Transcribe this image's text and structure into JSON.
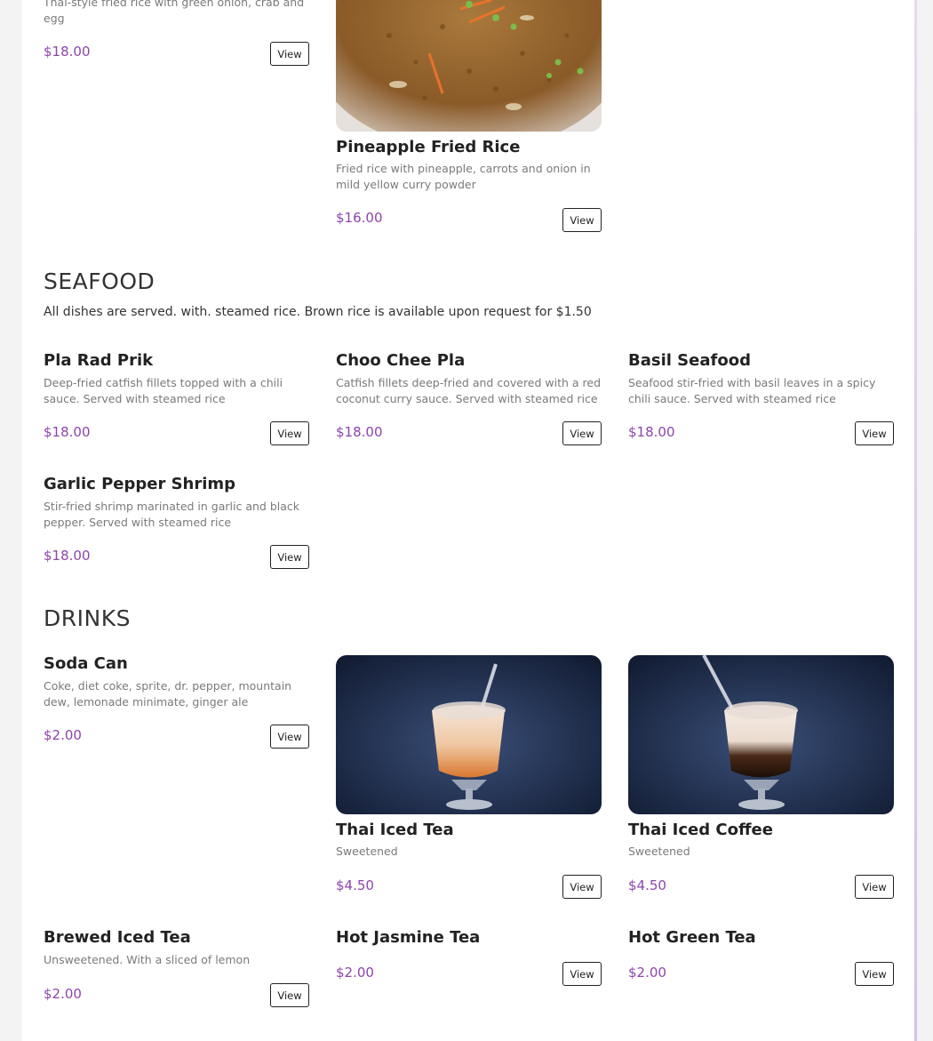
{
  "colors": {
    "price": "#8e44ad",
    "background": "#ffffff"
  },
  "top_left": {
    "desc": "Thai-style fried rice with green onion, crab and egg",
    "price": "$18.00",
    "view": "View"
  },
  "pineapple": {
    "name": "Pineapple Fried Rice",
    "desc": "Fried rice with pineapple, carrots and onion in mild yellow curry powder",
    "price": "$16.00",
    "view": "View"
  },
  "seafood": {
    "title": "SEAFOOD",
    "note": "All dishes are served. with. steamed rice. Brown rice is available upon request for $1.50",
    "items": [
      {
        "name": "Pla Rad Prik",
        "desc": "Deep-fried catfish fillets topped with a chili sauce. Served with steamed rice",
        "price": "$18.00",
        "view": "View"
      },
      {
        "name": "Choo Chee Pla",
        "desc": "Catfish fillets deep-fried and covered with a red coconut curry sauce. Served with steamed rice",
        "price": "$18.00",
        "view": "View"
      },
      {
        "name": "Basil Seafood",
        "desc": "Seafood stir-fried with basil leaves in a spicy chili sauce. Served with steamed rice",
        "price": "$18.00",
        "view": "View"
      },
      {
        "name": "Garlic Pepper Shrimp",
        "desc": "Stir-fried shrimp marinated in garlic and black pepper. Served with steamed rice",
        "price": "$18.00",
        "view": "View"
      }
    ]
  },
  "drinks": {
    "title": "DRINKS",
    "items": [
      {
        "name": "Soda Can",
        "desc": "Coke, diet coke, sprite, dr. pepper, mountain dew, lemonade minimate, ginger ale",
        "price": "$2.00",
        "view": "View"
      },
      {
        "name": "Thai Iced Tea",
        "desc": "Sweetened",
        "price": "$4.50",
        "view": "View"
      },
      {
        "name": "Thai Iced Coffee",
        "desc": "Sweetened",
        "price": "$4.50",
        "view": "View"
      },
      {
        "name": "Brewed Iced Tea",
        "desc": "Unsweetened. With a sliced of lemon",
        "price": "$2.00",
        "view": "View"
      },
      {
        "name": "Hot Jasmine Tea",
        "price": "$2.00",
        "view": "View"
      },
      {
        "name": "Hot Green Tea",
        "price": "$2.00",
        "view": "View"
      }
    ]
  }
}
